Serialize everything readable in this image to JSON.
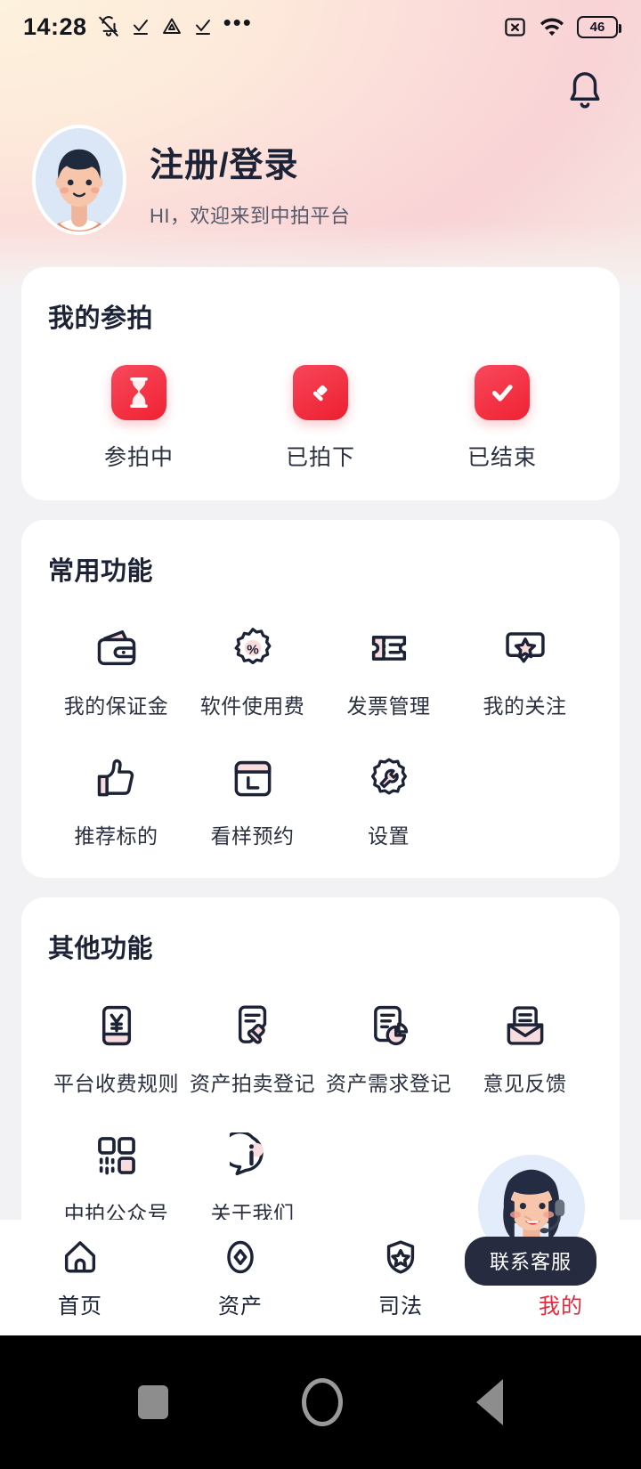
{
  "status_bar": {
    "time": "14:28",
    "left_icons": [
      "bell-mute-icon",
      "check-underline-icon",
      "triangle-alert-icon",
      "check-underline-icon",
      "more-dots-icon"
    ],
    "right_icons": [
      "sim-off-icon",
      "wifi-icon"
    ],
    "battery_level": "46"
  },
  "header": {
    "bell_icon": "bell-icon",
    "avatar": "user-avatar",
    "title": "注册/登录",
    "subtitle": "HI，欢迎来到中拍平台"
  },
  "my_bids": {
    "title": "我的参拍",
    "items": [
      {
        "label": "参拍中",
        "icon": "hourglass-icon"
      },
      {
        "label": "已拍下",
        "icon": "gavel-icon"
      },
      {
        "label": "已结束",
        "icon": "check-icon"
      }
    ]
  },
  "common_functions": {
    "title": "常用功能",
    "items": [
      {
        "label": "我的保证金",
        "icon": "wallet-icon"
      },
      {
        "label": "软件使用费",
        "icon": "percent-badge-icon"
      },
      {
        "label": "发票管理",
        "icon": "ticket-icon"
      },
      {
        "label": "我的关注",
        "icon": "star-bubble-icon"
      },
      {
        "label": "推荐标的",
        "icon": "thumbs-up-icon"
      },
      {
        "label": "看样预约",
        "icon": "calendar-icon"
      },
      {
        "label": "设置",
        "icon": "gear-wrench-icon"
      }
    ]
  },
  "other_functions": {
    "title": "其他功能",
    "items": [
      {
        "label": "平台收费规则",
        "icon": "yuan-doc-icon"
      },
      {
        "label": "资产拍卖登记",
        "icon": "doc-gavel-icon"
      },
      {
        "label": "资产需求登记",
        "icon": "doc-pie-icon"
      },
      {
        "label": "意见反馈",
        "icon": "envelope-icon"
      },
      {
        "label": "中拍公众号",
        "icon": "qrcode-icon"
      },
      {
        "label": "关于我们",
        "icon": "info-bubble-icon"
      }
    ]
  },
  "customer_service": {
    "label": "联系客服",
    "icon": "headset-agent-avatar"
  },
  "tabbar": {
    "items": [
      {
        "label": "首页",
        "icon": "home-icon",
        "active": false
      },
      {
        "label": "资产",
        "icon": "diamond-icon",
        "active": false
      },
      {
        "label": "司法",
        "icon": "shield-star-icon",
        "active": false
      },
      {
        "label": "我的",
        "icon": "profile-icon",
        "active": true
      }
    ]
  },
  "android_nav": {
    "items": [
      "recents-square-icon",
      "home-circle-icon",
      "back-triangle-icon"
    ]
  },
  "colors": {
    "accent_red": "#e8273a",
    "ink": "#1d2336",
    "pink_fill": "#f9dcdd",
    "card_bg": "#ffffff",
    "page_bg": "#f2f2f4"
  }
}
